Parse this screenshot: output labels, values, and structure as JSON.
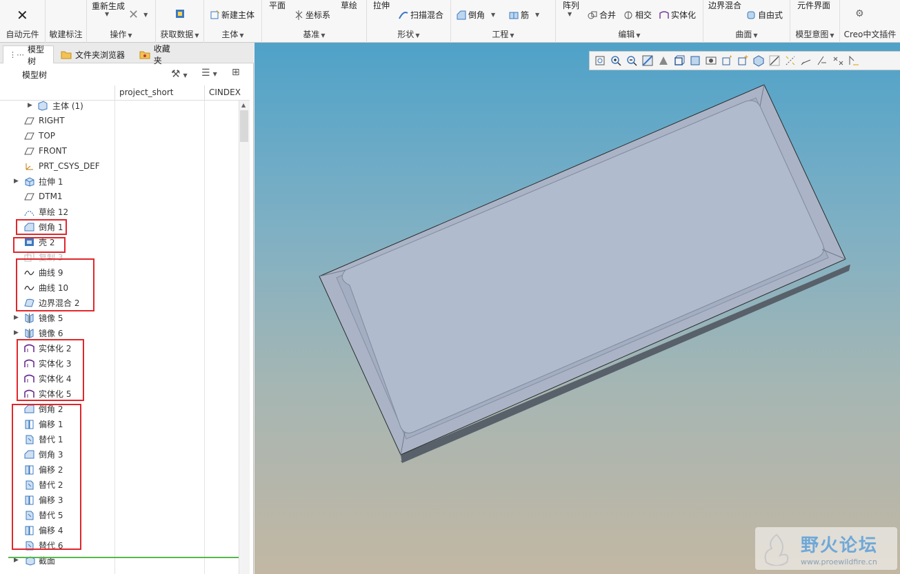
{
  "ribbon": {
    "groups": [
      {
        "label": "自动元件"
      },
      {
        "label": "敏建标注"
      },
      {
        "label": "操作",
        "buttons": [
          "重新生成"
        ]
      },
      {
        "label": "获取数据"
      },
      {
        "label": "主体",
        "buttons": [
          "新建主体"
        ]
      },
      {
        "label": "基准",
        "buttons": [
          "平面",
          "坐标系",
          "草绘"
        ]
      },
      {
        "label": "形状",
        "buttons": [
          "拉伸",
          "扫描混合"
        ]
      },
      {
        "label": "工程",
        "buttons": [
          "倒角",
          "筋"
        ]
      },
      {
        "label": "编辑",
        "buttons": [
          "阵列",
          "合并",
          "相交",
          "实体化"
        ]
      },
      {
        "label": "曲面",
        "buttons": [
          "边界混合",
          "自由式"
        ]
      },
      {
        "label": "模型意图",
        "buttons": [
          "元件界面"
        ]
      },
      {
        "label": "Creo中文插件"
      }
    ]
  },
  "panel": {
    "tabs": [
      "模型树",
      "文件夹浏览器",
      "收藏夹"
    ],
    "title": "模型树",
    "columns": [
      "project_short",
      "CINDEX"
    ]
  },
  "tree": [
    {
      "label": "主体 (1)",
      "icon": "body-icon",
      "expand": true
    },
    {
      "label": "RIGHT",
      "icon": "datum-plane-icon",
      "expand": false
    },
    {
      "label": "TOP",
      "icon": "datum-plane-icon",
      "expand": false
    },
    {
      "label": "FRONT",
      "icon": "datum-plane-icon",
      "expand": false
    },
    {
      "label": "PRT_CSYS_DEF",
      "icon": "csys-icon",
      "expand": false
    },
    {
      "label": "拉伸 1",
      "icon": "extrude-icon",
      "expand": true
    },
    {
      "label": "DTM1",
      "icon": "datum-plane-icon",
      "expand": false
    },
    {
      "label": "草绘 12",
      "icon": "sketch-icon",
      "expand": false
    },
    {
      "label": "倒角 1",
      "icon": "chamfer-icon",
      "expand": false
    },
    {
      "label": "壳 2",
      "icon": "shell-icon",
      "expand": false
    },
    {
      "label": "复制 3",
      "icon": "copy-icon",
      "expand": false
    },
    {
      "label": "曲线 9",
      "icon": "curve-icon",
      "expand": false
    },
    {
      "label": "曲线 10",
      "icon": "curve-icon",
      "expand": false
    },
    {
      "label": "边界混合 2",
      "icon": "boundary-blend-icon",
      "expand": false
    },
    {
      "label": "镜像 5",
      "icon": "mirror-icon",
      "expand": true
    },
    {
      "label": "镜像 6",
      "icon": "mirror-icon",
      "expand": true
    },
    {
      "label": "实体化 2",
      "icon": "solidify-icon",
      "expand": false
    },
    {
      "label": "实体化 3",
      "icon": "solidify-icon",
      "expand": false
    },
    {
      "label": "实体化 4",
      "icon": "solidify-icon",
      "expand": false
    },
    {
      "label": "实体化 5",
      "icon": "solidify-icon",
      "expand": false
    },
    {
      "label": "倒角 2",
      "icon": "chamfer-icon",
      "expand": false
    },
    {
      "label": "偏移 1",
      "icon": "offset-icon",
      "expand": false
    },
    {
      "label": "替代 1",
      "icon": "replace-icon",
      "expand": false
    },
    {
      "label": "倒角 3",
      "icon": "chamfer-icon",
      "expand": false
    },
    {
      "label": "偏移 2",
      "icon": "offset-icon",
      "expand": false
    },
    {
      "label": "替代 2",
      "icon": "replace-icon",
      "expand": false
    },
    {
      "label": "偏移 3",
      "icon": "offset-icon",
      "expand": false
    },
    {
      "label": "替代 5",
      "icon": "replace-icon",
      "expand": false
    },
    {
      "label": "偏移 4",
      "icon": "offset-icon",
      "expand": false
    },
    {
      "label": "替代 6",
      "icon": "replace-icon",
      "expand": false
    },
    {
      "label": "截面",
      "icon": "section-icon",
      "expand": true
    }
  ],
  "watermark": {
    "title": "野火论坛",
    "url": "www.proewildfire.cn"
  },
  "colors": {
    "highlight": "#e0262b",
    "insert_line": "#55b84a",
    "viewport_top": "#4fa2c9",
    "viewport_bottom": "#c2b7a3"
  }
}
